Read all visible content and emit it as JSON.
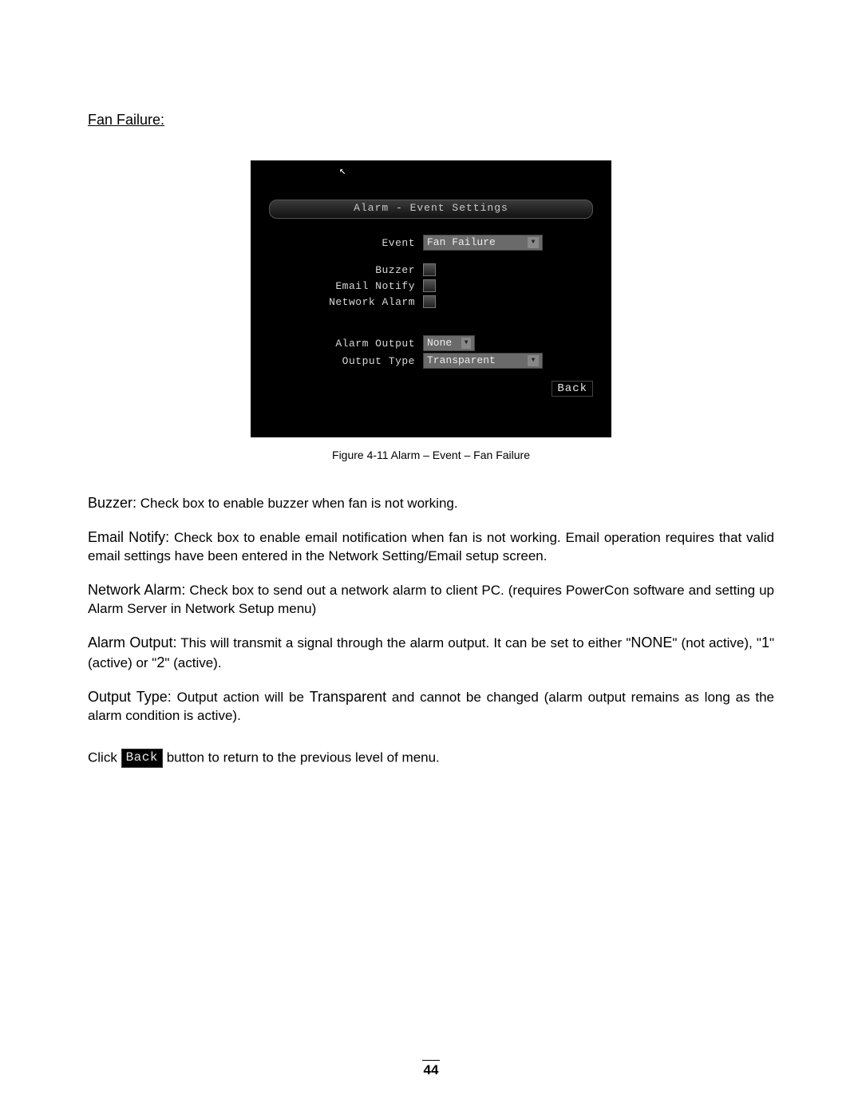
{
  "section_title": "Fan Failure:",
  "screenshot": {
    "title": "Alarm - Event Settings",
    "fields": {
      "event_label": "Event",
      "event_value": "Fan Failure",
      "buzzer_label": "Buzzer",
      "email_label": "Email Notify",
      "network_label": "Network Alarm",
      "alarm_output_label": "Alarm Output",
      "alarm_output_value": "None",
      "output_type_label": "Output Type",
      "output_type_value": "Transparent"
    },
    "back_button": "Back"
  },
  "caption": "Figure 4-11 Alarm – Event – Fan Failure",
  "paragraphs": {
    "buzzer_term": "Buzzer:",
    "buzzer_text": " Check box to enable buzzer when fan is not working.",
    "email_term": "Email Notify:",
    "email_text": " Check box to enable email notification when fan is not working.  Email operation requires that valid email settings have been entered in the Network Setting/Email setup screen.",
    "network_term": "Network Alarm:",
    "network_text": " Check box to send out a network alarm to client PC. (requires PowerCon software and setting up Alarm Server in Network Setup menu)",
    "alarm_term": "Alarm Output:",
    "alarm_text_a": " This will transmit a signal through the alarm output. It can be set to either \"",
    "alarm_none": "NONE",
    "alarm_text_b": "\" (not active), \"",
    "alarm_one": "1",
    "alarm_text_c": "\"(active) or \"",
    "alarm_two": "2",
    "alarm_text_d": "\" (active).",
    "output_term": "Output Type:",
    "output_text_a": " Output action will be ",
    "output_trans": "Transparent",
    "output_text_b": " and cannot be changed (alarm output remains as long as the alarm condition is active).",
    "click_a": "Click ",
    "click_back": "Back",
    "click_b": " button to return to the previous level of menu."
  },
  "page_number": "44"
}
